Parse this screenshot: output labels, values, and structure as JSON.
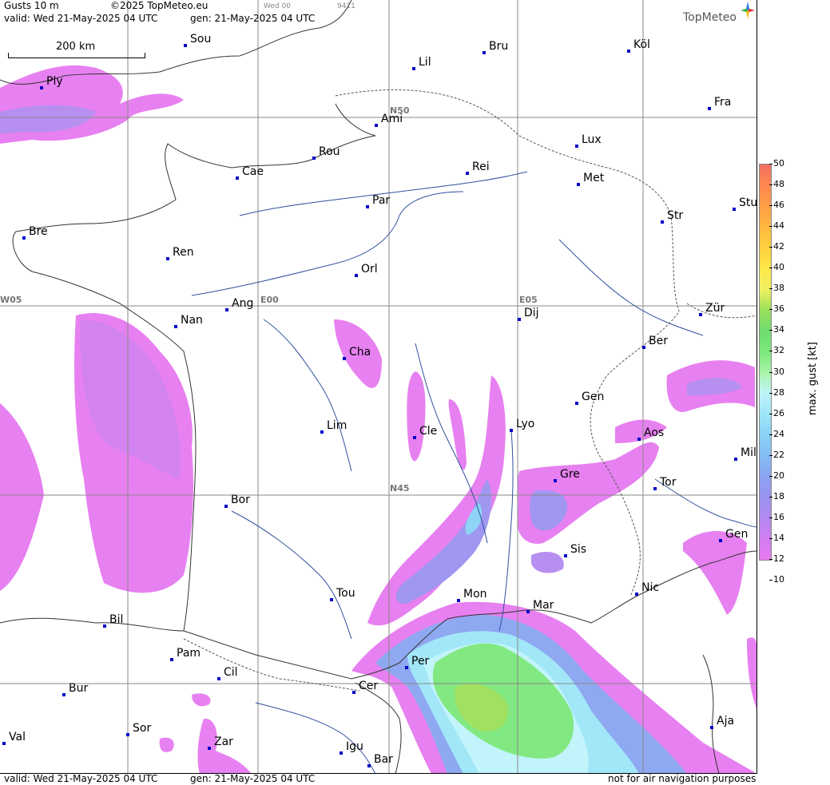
{
  "header": {
    "title": "Gusts 10 m",
    "copyright": "©2025 TopMeteo.eu",
    "day_code": "Wed 00",
    "run_code": "9411",
    "valid": "valid:  Wed  21-May-2025  04 UTC",
    "gen": "gen: 21-May-2025 04 UTC",
    "logo": "TopMeteo"
  },
  "footer": {
    "valid": "valid:  Wed  21-May-2025  04 UTC",
    "gen": "gen: 21-May-2025 04 UTC",
    "disclaimer": "not for air navigation purposes"
  },
  "scale": {
    "label": "200 km"
  },
  "grid_labels": {
    "n50": "N50",
    "n45": "N45",
    "w05": "W05",
    "e00": "E00",
    "e05": "E05"
  },
  "cities": [
    {
      "name": "Sou"
    },
    {
      "name": "Ply"
    },
    {
      "name": "Bru"
    },
    {
      "name": "Köl"
    },
    {
      "name": "Lil"
    },
    {
      "name": "Fra"
    },
    {
      "name": "Ami"
    },
    {
      "name": "Lux"
    },
    {
      "name": "Rou"
    },
    {
      "name": "Cae"
    },
    {
      "name": "Rei"
    },
    {
      "name": "Met"
    },
    {
      "name": "Par"
    },
    {
      "name": "Stu"
    },
    {
      "name": "Str"
    },
    {
      "name": "Bre"
    },
    {
      "name": "Ren"
    },
    {
      "name": "Orl"
    },
    {
      "name": "Ang"
    },
    {
      "name": "Nan"
    },
    {
      "name": "Dij"
    },
    {
      "name": "Zür"
    },
    {
      "name": "Ber"
    },
    {
      "name": "Cha"
    },
    {
      "name": "Gen"
    },
    {
      "name": "Lim"
    },
    {
      "name": "Cle"
    },
    {
      "name": "Lyo"
    },
    {
      "name": "Aos"
    },
    {
      "name": "Mil"
    },
    {
      "name": "Gre"
    },
    {
      "name": "Tor"
    },
    {
      "name": "Bor"
    },
    {
      "name": "Sis"
    },
    {
      "name": "Gen"
    },
    {
      "name": "Tou"
    },
    {
      "name": "Mon"
    },
    {
      "name": "Mar"
    },
    {
      "name": "Nic"
    },
    {
      "name": "Bil"
    },
    {
      "name": "Pam"
    },
    {
      "name": "Per"
    },
    {
      "name": "Cil"
    },
    {
      "name": "Bur"
    },
    {
      "name": "Cer"
    },
    {
      "name": "Ajа"
    },
    {
      "name": "Sor"
    },
    {
      "name": "Val"
    },
    {
      "name": "Zar"
    },
    {
      "name": "Igu"
    },
    {
      "name": "Bar"
    }
  ],
  "legend": {
    "title": "max. gust  [kt]",
    "ticks": [
      "50",
      "48",
      "46",
      "44",
      "42",
      "40",
      "38",
      "36",
      "34",
      "32",
      "30",
      "28",
      "26",
      "24",
      "22",
      "20",
      "18",
      "16",
      "14",
      "12",
      "10"
    ],
    "colors": {
      "c12": "#e67af0",
      "c14": "#d07df0",
      "c16": "#b48af0",
      "c18": "#9a92f0",
      "c20": "#8aa4f2",
      "c22": "#84bcf4",
      "c24": "#8ad2f6",
      "c26": "#9ee6f8",
      "c28": "#bff4fb",
      "c30": "#a9f4a9",
      "c32": "#7ce87c",
      "c34": "#6fdc6f",
      "c36": "#9be05a",
      "c38": "#f0f060",
      "c40": "#ffe84a",
      "c42": "#ffd040",
      "c44": "#ffb840",
      "c46": "#ff9e48",
      "c48": "#ff8850",
      "c50": "#f07060"
    }
  }
}
